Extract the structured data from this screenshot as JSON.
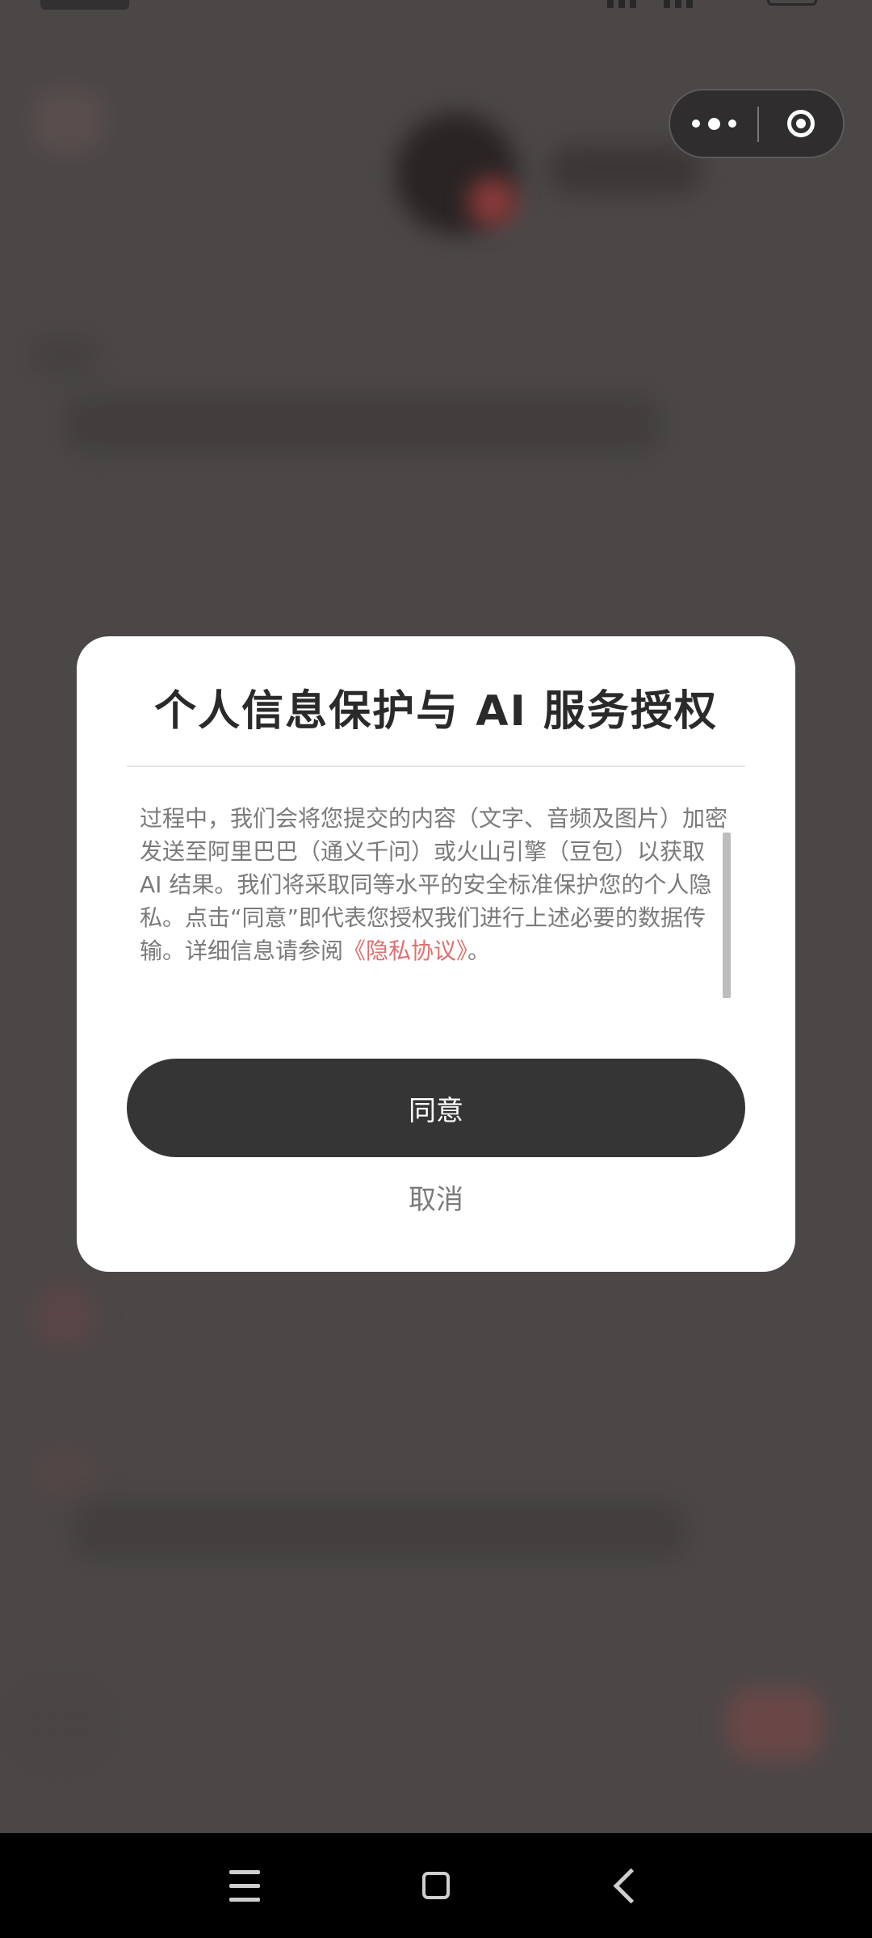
{
  "modal": {
    "title": "个人信息保护与 AI 服务授权",
    "body_text": "过程中，我们会将您提交的内容（文字、音频及图片）加密发送至阿里巴巴（通义千问）或火山引擎（豆包）以获取 AI 结果。我们将采取同等水平的安全标准保护您的个人隐私。点击“同意”即代表您授权我们进行上述必要的数据传输。详细信息请参阅",
    "privacy_link": "《隐私协议》",
    "body_end": "。",
    "agree_label": "同意",
    "cancel_label": "取消"
  },
  "capsule": {
    "more_icon": "more-dots-icon",
    "close_icon": "close-target-icon"
  },
  "nav": {
    "menu_icon": "menu-icon",
    "home_icon": "home-icon",
    "back_icon": "back-icon"
  },
  "colors": {
    "overlay": "#4b4747",
    "primary_button": "#353535",
    "link": "#e06f6f",
    "body_text": "#7a7a7a",
    "title_text": "#2a2a2a"
  }
}
